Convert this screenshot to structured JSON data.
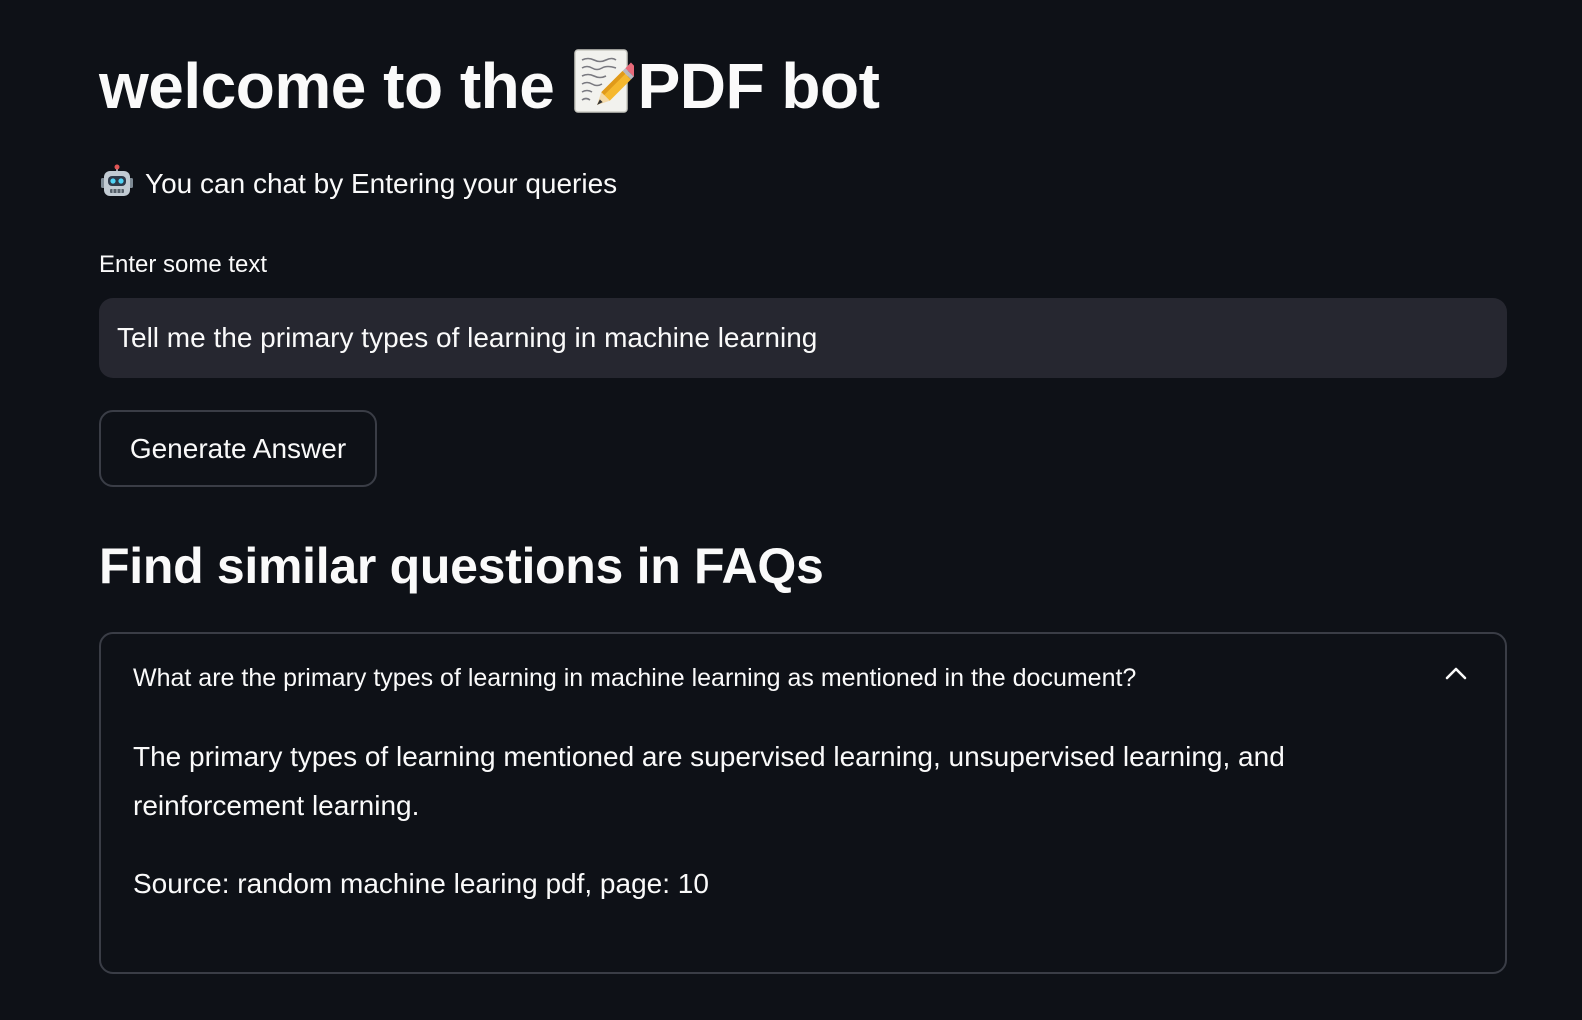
{
  "header": {
    "title_prefix": "welcome to the ",
    "title_icon": "memo-icon",
    "title_suffix": "PDF bot",
    "subtitle_icon": "robot-icon",
    "subtitle": "You can chat by Entering your queries"
  },
  "query_form": {
    "label": "Enter some text",
    "input_value": "Tell me the primary types of learning in machine learning",
    "button_label": "Generate Answer"
  },
  "faq_section": {
    "heading": "Find similar questions in FAQs",
    "expander": {
      "expanded": true,
      "toggle_icon": "chevron-up-icon",
      "question": "What are the primary types of learning in machine learning as mentioned in the document?",
      "answer": "The primary types of learning mentioned are supervised learning, unsupervised learning, and reinforcement learning.",
      "source": "Source: random machine learing pdf, page: 10"
    }
  },
  "colors": {
    "background": "#0e1117",
    "input_background": "#262730",
    "border": "#3a3d46",
    "text": "#fafafa"
  }
}
